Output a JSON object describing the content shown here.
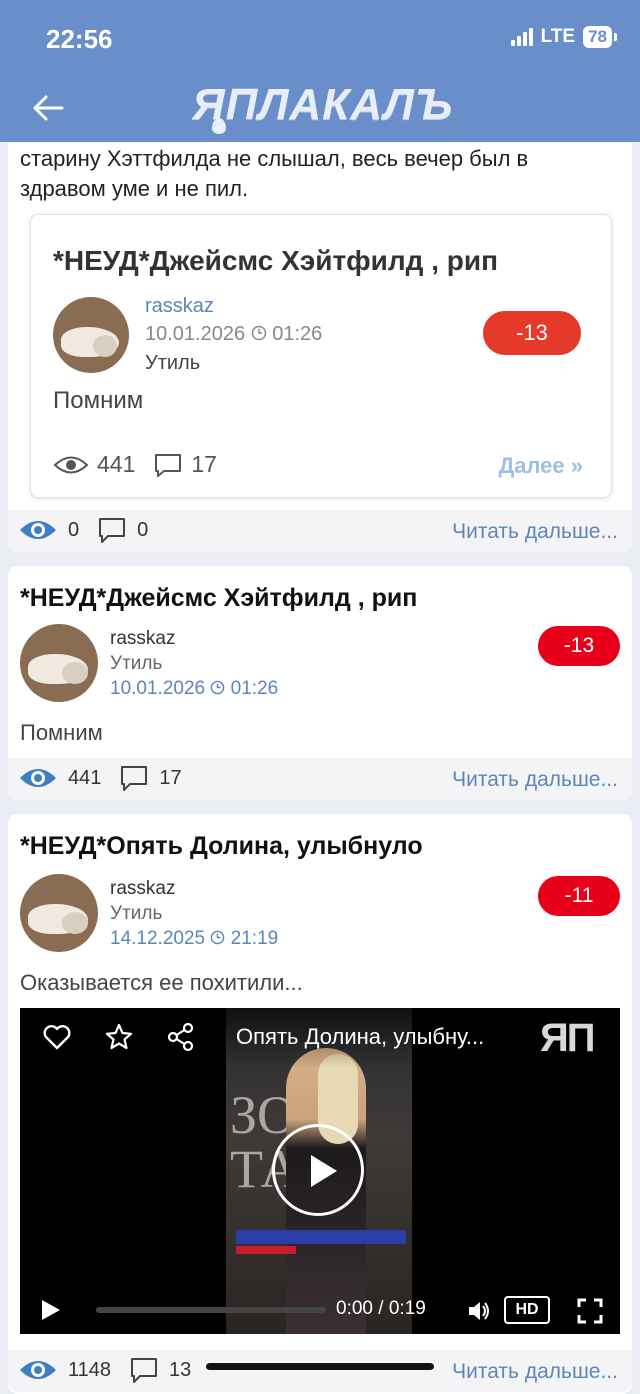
{
  "status_bar": {
    "time": "22:56",
    "network": "LTE",
    "battery": "78"
  },
  "header": {
    "logo": "ЯПЛАКАЛЪ"
  },
  "comment": {
    "text": "старину Хэттфилда не слышал, весь вечер был в здравом уме и не пил.",
    "quote": {
      "title": "*НЕУД*Джейсмс Хэйтфилд , рип",
      "author": "rasskaz",
      "date": "10.01.2026",
      "time": "01:26",
      "category": "Утиль",
      "rating": "-13",
      "body": "Помним",
      "views": "441",
      "comments": "17",
      "more": "Далее »"
    },
    "stats": {
      "views": "0",
      "comments": "0",
      "more": "Читать дальше..."
    }
  },
  "posts": [
    {
      "title": "*НЕУД*Джейсмс Хэйтфилд , рип",
      "author": "rasskaz",
      "category": "Утиль",
      "date": "10.01.2026",
      "time": "01:26",
      "rating": "-13",
      "body": "Помним",
      "views": "441",
      "comments": "17",
      "more": "Читать дальше..."
    },
    {
      "title": "*НЕУД*Опять Долина, улыбнуло",
      "author": "rasskaz",
      "category": "Утиль",
      "date": "14.12.2025",
      "time": "21:19",
      "rating": "-11",
      "body": "Оказывается ее похитили...",
      "video": {
        "title": "Опять Долина, улыбну...",
        "logo": "ЯП",
        "frame_text": "ЗО\nТА",
        "current_time": "0:00",
        "separator": "/",
        "duration": "0:19",
        "quality": "HD"
      },
      "views": "1148",
      "comments": "13",
      "more": "Читать дальше..."
    }
  ],
  "colors": {
    "header": "#6a8ec9",
    "link": "#5a86b8",
    "rating_badge": "#e8001a",
    "eye_icon": "#3d7fc2"
  }
}
